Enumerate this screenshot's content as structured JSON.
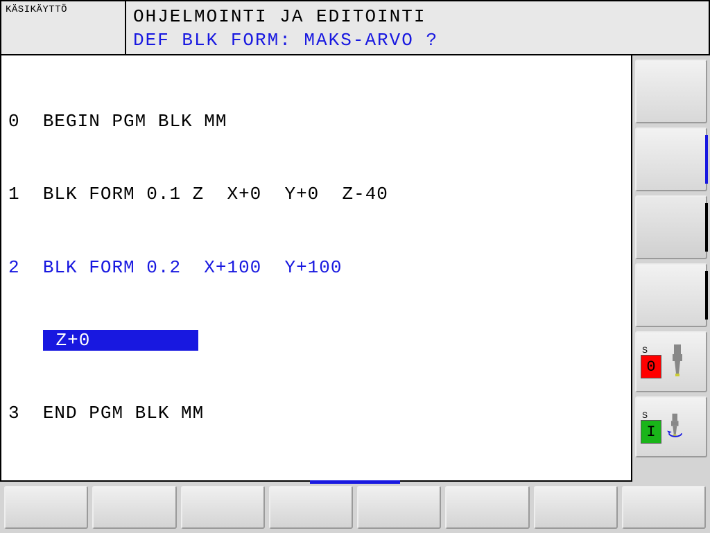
{
  "header": {
    "mode_label": "KÄSIKÄYTTÖ",
    "title_line1": "OHJELMOINTI JA EDITOINTI",
    "title_line2": "DEF BLK FORM: MAKS-ARVO ?"
  },
  "program": {
    "lines": [
      {
        "n": "0",
        "text": "BEGIN PGM BLK MM",
        "style": "normal"
      },
      {
        "n": "1",
        "text": "BLK FORM 0.1 Z  X+0  Y+0  Z-40",
        "style": "normal"
      },
      {
        "n": "2",
        "text": "BLK FORM 0.2  X+100  Y+100",
        "style": "blue"
      },
      {
        "n": "",
        "text": "Z+0",
        "style": "highlight"
      },
      {
        "n": "3",
        "text": "END PGM BLK MM",
        "style": "normal"
      }
    ],
    "highlight_value": " Z+0 "
  },
  "side_softkeys": {
    "status_s0": {
      "label": "S",
      "value": "0"
    },
    "status_s1": {
      "label": "S",
      "value": "I"
    }
  }
}
